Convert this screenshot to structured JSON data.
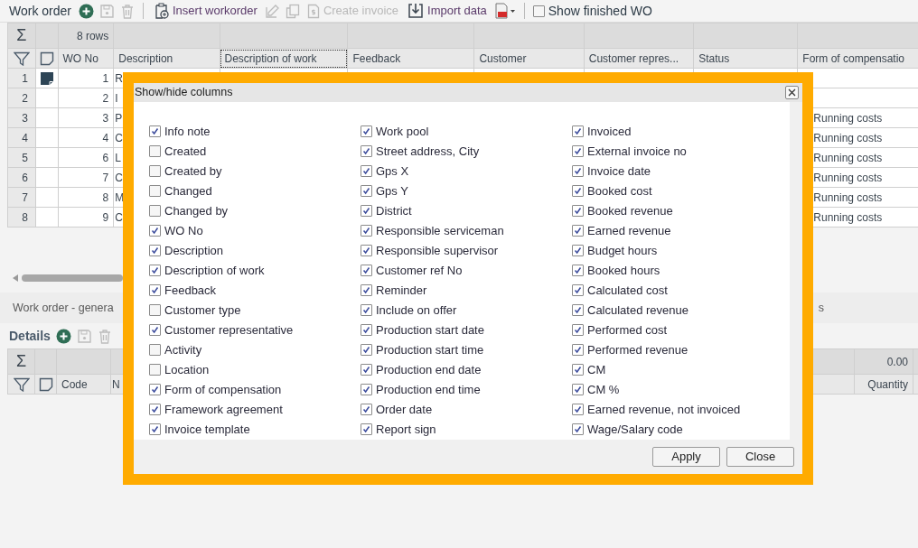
{
  "toolbar": {
    "title": "Work order",
    "actions": [
      {
        "label": "Insert workorder",
        "disabled": false
      },
      {
        "label": "Create invoice",
        "disabled": true
      },
      {
        "label": "Import data",
        "disabled": false
      }
    ],
    "show_finished": {
      "label": "Show finished WO",
      "checked": false
    }
  },
  "grid": {
    "sum_icon": "Σ",
    "summary": "8 rows",
    "columns": [
      {
        "label": "WO No",
        "focused": false
      },
      {
        "label": "Description",
        "focused": false
      },
      {
        "label": "Description of work",
        "focused": true
      },
      {
        "label": "Feedback",
        "focused": false
      },
      {
        "label": "Customer",
        "focused": false
      },
      {
        "label": "Customer repres...",
        "focused": false
      },
      {
        "label": "Status",
        "focused": false
      },
      {
        "label": "Form of compensatio",
        "focused": false
      }
    ],
    "rows": [
      {
        "number": "1",
        "has_note": true,
        "wo_no": "1",
        "description": "R"
      },
      {
        "number": "2",
        "has_note": false,
        "wo_no": "2",
        "description": "I"
      },
      {
        "number": "3",
        "has_note": false,
        "wo_no": "3",
        "description": "P",
        "form_of_compensation": "Running costs"
      },
      {
        "number": "4",
        "has_note": false,
        "wo_no": "4",
        "description": "C",
        "form_of_compensation": "Running costs"
      },
      {
        "number": "5",
        "has_note": false,
        "wo_no": "6",
        "description": "L",
        "form_of_compensation": "Running costs"
      },
      {
        "number": "6",
        "has_note": false,
        "wo_no": "7",
        "description": "C",
        "form_of_compensation": "Running costs"
      },
      {
        "number": "7",
        "has_note": false,
        "wo_no": "8",
        "description": "M",
        "form_of_compensation": "Running costs"
      },
      {
        "number": "8",
        "has_note": false,
        "wo_no": "9",
        "description": "C",
        "form_of_compensation": "Running costs"
      }
    ]
  },
  "tab_bar": [
    "Work order - genera",
    "s"
  ],
  "details": {
    "title": "Details",
    "sum_icon": "Σ",
    "summary_value": "0.00",
    "columns": [
      "Code",
      "N",
      "Quantity"
    ]
  },
  "dialog": {
    "title": "Show/hide columns",
    "columns": [
      [
        {
          "label": "Info note",
          "checked": true
        },
        {
          "label": "Created",
          "checked": false
        },
        {
          "label": "Created by",
          "checked": false
        },
        {
          "label": "Changed",
          "checked": false
        },
        {
          "label": "Changed by",
          "checked": false
        },
        {
          "label": "WO No",
          "checked": true
        },
        {
          "label": "Description",
          "checked": true
        },
        {
          "label": "Description of work",
          "checked": true
        },
        {
          "label": "Feedback",
          "checked": true
        },
        {
          "label": "Customer type",
          "checked": false
        },
        {
          "label": "Customer representative",
          "checked": true
        },
        {
          "label": "Activity",
          "checked": false
        },
        {
          "label": "Location",
          "checked": false
        },
        {
          "label": "Form of compensation",
          "checked": true
        },
        {
          "label": "Framework agreement",
          "checked": true
        },
        {
          "label": "Invoice template",
          "checked": true
        }
      ],
      [
        {
          "label": "Work pool",
          "checked": true
        },
        {
          "label": "Street address, City",
          "checked": true
        },
        {
          "label": "Gps X",
          "checked": true
        },
        {
          "label": "Gps Y",
          "checked": true
        },
        {
          "label": "District",
          "checked": true
        },
        {
          "label": "Responsible serviceman",
          "checked": true
        },
        {
          "label": "Responsible supervisor",
          "checked": true
        },
        {
          "label": "Customer ref No",
          "checked": true
        },
        {
          "label": "Reminder",
          "checked": true
        },
        {
          "label": "Include on offer",
          "checked": true
        },
        {
          "label": "Production start date",
          "checked": true
        },
        {
          "label": "Production start time",
          "checked": true
        },
        {
          "label": "Production end date",
          "checked": true
        },
        {
          "label": "Production end time",
          "checked": true
        },
        {
          "label": "Order date",
          "checked": true
        },
        {
          "label": "Report sign",
          "checked": true
        }
      ],
      [
        {
          "label": "Invoiced",
          "checked": true
        },
        {
          "label": "External invoice no",
          "checked": true
        },
        {
          "label": "Invoice date",
          "checked": true
        },
        {
          "label": "Booked cost",
          "checked": true
        },
        {
          "label": "Booked revenue",
          "checked": true
        },
        {
          "label": "Earned revenue",
          "checked": true
        },
        {
          "label": "Budget hours",
          "checked": true
        },
        {
          "label": "Booked hours",
          "checked": true
        },
        {
          "label": "Calculated cost",
          "checked": true
        },
        {
          "label": "Calculated revenue",
          "checked": true
        },
        {
          "label": "Performed cost",
          "checked": true
        },
        {
          "label": "Performed revenue",
          "checked": true
        },
        {
          "label": "CM",
          "checked": true
        },
        {
          "label": "CM %",
          "checked": true
        },
        {
          "label": "Earned revenue, not invoiced",
          "checked": true
        },
        {
          "label": "Wage/Salary code",
          "checked": true
        }
      ]
    ],
    "buttons": [
      "Apply",
      "Close"
    ]
  }
}
